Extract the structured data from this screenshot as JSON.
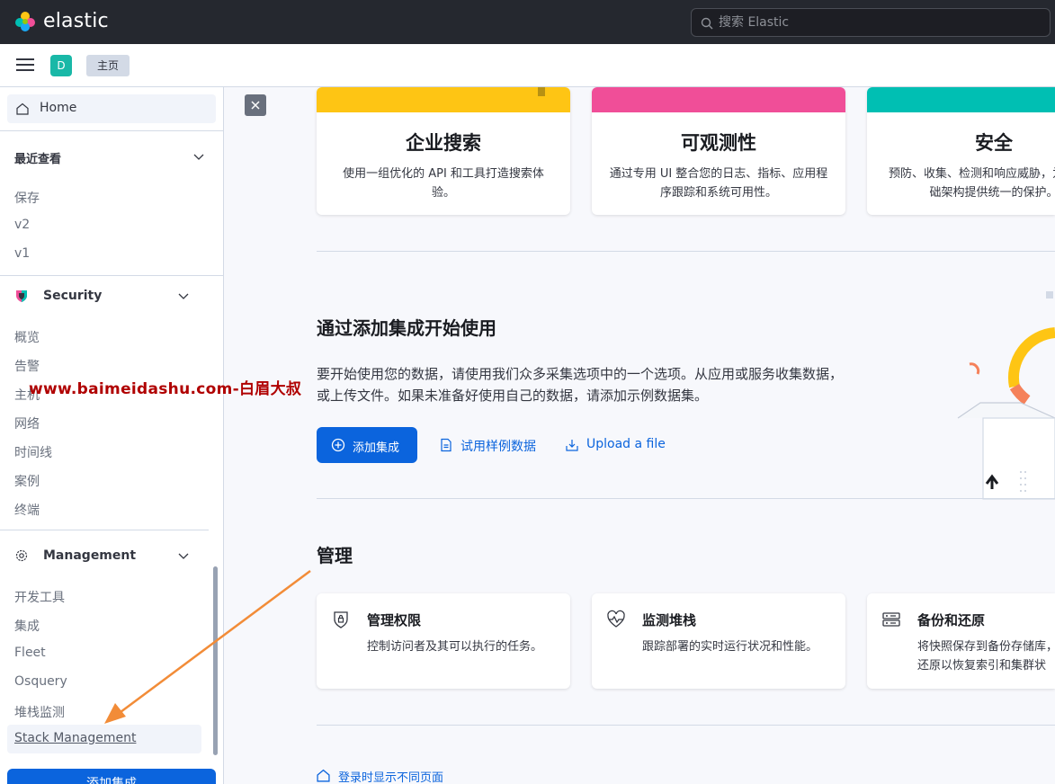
{
  "header": {
    "brand": "elastic",
    "search_placeholder": "搜索 Elastic"
  },
  "subbar": {
    "space_initial": "D",
    "breadcrumb": "主页"
  },
  "sidebar": {
    "home": "Home",
    "recent": {
      "title": "最近查看",
      "items": [
        "保存",
        "v2",
        "v1"
      ]
    },
    "security": {
      "title": "Security",
      "items": [
        "概览",
        "告警",
        "主机",
        "网络",
        "时间线",
        "案例",
        "终端"
      ]
    },
    "management": {
      "title": "Management",
      "items": [
        "开发工具",
        "集成",
        "Fleet",
        "Osquery",
        "堆栈监测",
        "Stack Management"
      ]
    },
    "add_integrations": "添加集成"
  },
  "watermark": "www.baimeidashu.com-白眉大叔",
  "solutions": [
    {
      "title": "企业搜索",
      "desc": "使用一组优化的 API 和工具打造搜索体验。",
      "band_color": "#fec514"
    },
    {
      "title": "可观测性",
      "desc": "通过专用 UI 整合您的日志、指标、应用程序跟踪和系统可用性。",
      "band_color": "#f04e98"
    },
    {
      "title": "安全",
      "desc": "预防、收集、检测和响应威胁，为整个基础架构提供统一的保护。",
      "band_color": "#00bfb3"
    }
  ],
  "get_started": {
    "title": "通过添加集成开始使用",
    "desc": "要开始使用您的数据，请使用我们众多采集选项中的一个选项。从应用或服务收集数据，或上传文件。如果未准备好使用自己的数据，请添加示例数据集。",
    "add_button": "添加集成",
    "sample_button": "试用样例数据",
    "upload_button": "Upload a file"
  },
  "management": {
    "title": "管理",
    "cards": [
      {
        "title": "管理权限",
        "desc": "控制访问者及其可以执行的任务。"
      },
      {
        "title": "监测堆栈",
        "desc": "跟踪部署的实时运行状况和性能。"
      },
      {
        "title": "备份和还原",
        "desc": "将快照保存到备份存储库，还原以恢复索引和集群状态。"
      }
    ]
  },
  "footer": {
    "link": "登录时显示不同页面"
  },
  "colors": {
    "accent": "#0b64dd",
    "header_bg": "#25282f",
    "arrow": "#f28c38"
  }
}
